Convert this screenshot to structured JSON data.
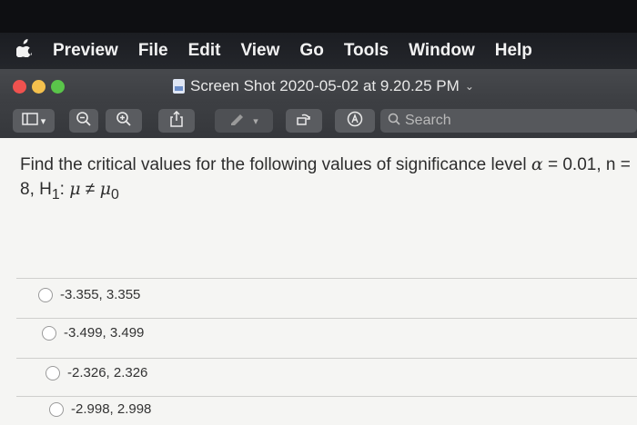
{
  "menubar": {
    "apple": "",
    "items": [
      "Preview",
      "File",
      "Edit",
      "View",
      "Go",
      "Tools",
      "Window",
      "Help"
    ]
  },
  "window": {
    "title": "Screen Shot 2020-05-02 at 9.20.25 PM",
    "search_placeholder": "Search"
  },
  "question": {
    "text_1": "Find the critical values for the following values of significance level",
    "alpha": "α",
    "text_2": "= 0.01, n =",
    "text_3": "8, H",
    "sub1": "1",
    "text_4": ": ",
    "mu": "μ",
    "neq": " ≠ ",
    "mu0": "μ",
    "sub0": "0"
  },
  "options": [
    "-3.355, 3.355",
    "-3.499, 3.499",
    "-2.326, 2.326",
    "-2.998, 2.998"
  ],
  "colors": {
    "close": "#f0524f",
    "minimize": "#f4c04d",
    "zoom": "#5ac54a"
  }
}
